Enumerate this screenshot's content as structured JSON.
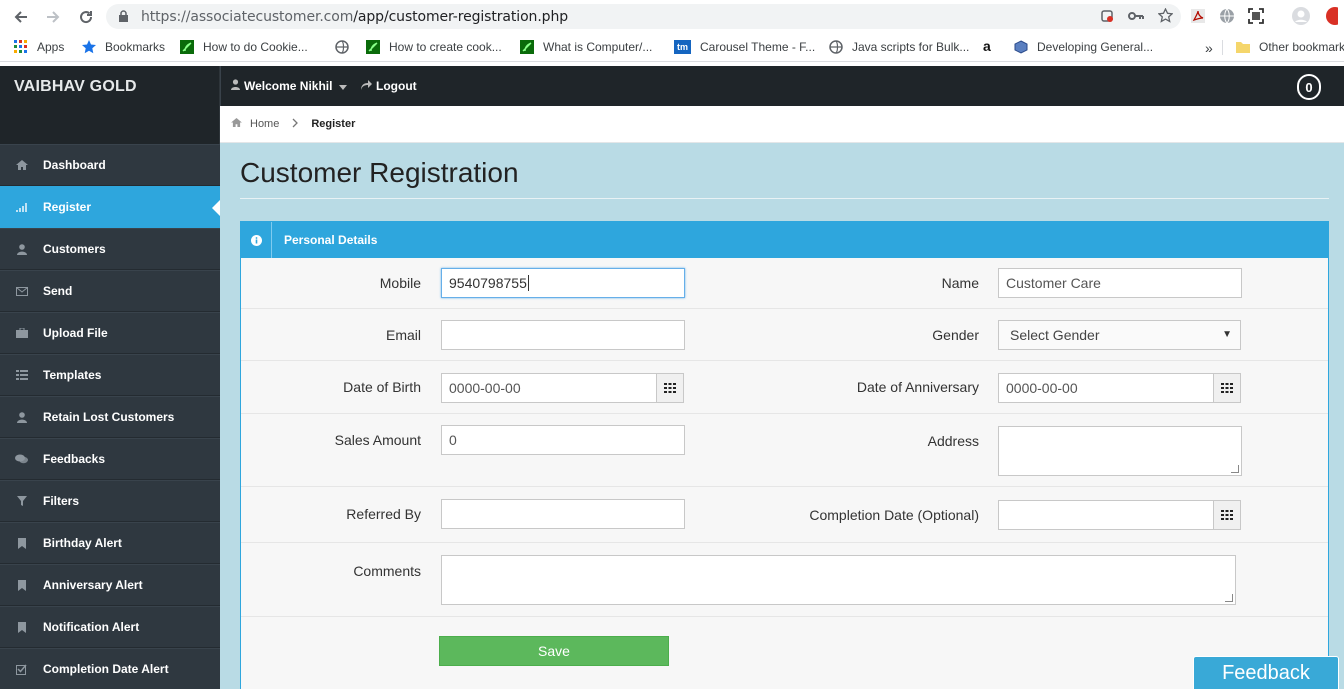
{
  "browser": {
    "url_host": "https://associatecustomer.com",
    "url_path": "/app/customer-registration.php",
    "bookmarks": [
      {
        "label": "Apps",
        "icon": "apps-grid-icon"
      },
      {
        "label": "Bookmarks",
        "icon": "star-icon"
      },
      {
        "label": "How to do Cookie...",
        "icon": "green-leaf-icon"
      },
      {
        "label": "",
        "icon": "globe-icon"
      },
      {
        "label": "How to create cook...",
        "icon": "green-leaf-icon"
      },
      {
        "label": "What is Computer/...",
        "icon": "green-leaf-icon"
      },
      {
        "label": "Carousel Theme - F...",
        "icon": "tm-icon"
      },
      {
        "label": "Java scripts for Bulk...",
        "icon": "globe-icon"
      },
      {
        "label": "",
        "icon": "amazon-icon"
      },
      {
        "label": "Developing General...",
        "icon": "cube-icon"
      },
      {
        "label": "»",
        "icon": ""
      },
      {
        "label": "Other bookmarks",
        "icon": "folder-icon"
      }
    ]
  },
  "app": {
    "brand": "VAIBHAV GOLD",
    "welcome": "Welcome Nikhil",
    "logout": "Logout",
    "notification_count": "0",
    "accent": "#2ea6dd"
  },
  "sidebar": {
    "items": [
      {
        "label": "Dashboard",
        "icon": "home-icon"
      },
      {
        "label": "Register",
        "icon": "signal-icon",
        "active": true
      },
      {
        "label": "Customers",
        "icon": "user-icon"
      },
      {
        "label": "Send",
        "icon": "envelope-icon"
      },
      {
        "label": "Upload File",
        "icon": "briefcase-icon"
      },
      {
        "label": "Templates",
        "icon": "grid-icon"
      },
      {
        "label": "Retain Lost Customers",
        "icon": "user-icon"
      },
      {
        "label": "Feedbacks",
        "icon": "comments-icon"
      },
      {
        "label": "Filters",
        "icon": "filter-icon"
      },
      {
        "label": "Birthday Alert",
        "icon": "bookmark-icon"
      },
      {
        "label": "Anniversary Alert",
        "icon": "bookmark-icon"
      },
      {
        "label": "Notification Alert",
        "icon": "bookmark-icon"
      },
      {
        "label": "Completion Date Alert",
        "icon": "check-square-icon"
      }
    ]
  },
  "breadcrumb": {
    "home": "Home",
    "current": "Register"
  },
  "page": {
    "title": "Customer Registration",
    "panel_title": "Personal Details"
  },
  "form": {
    "mobile": {
      "label": "Mobile",
      "value": "9540798755"
    },
    "name": {
      "label": "Name",
      "value": "Customer Care"
    },
    "email": {
      "label": "Email",
      "value": ""
    },
    "gender": {
      "label": "Gender",
      "value": "Select Gender"
    },
    "dob": {
      "label": "Date of Birth",
      "value": "0000-00-00"
    },
    "anniversary": {
      "label": "Date of Anniversary",
      "value": "0000-00-00"
    },
    "sales_amount": {
      "label": "Sales Amount",
      "value": "0"
    },
    "address": {
      "label": "Address",
      "value": ""
    },
    "referred_by": {
      "label": "Referred By",
      "value": ""
    },
    "completion_date": {
      "label": "Completion Date (Optional)",
      "value": ""
    },
    "comments": {
      "label": "Comments",
      "value": ""
    },
    "save": "Save"
  },
  "feedback_tab": "Feedback"
}
